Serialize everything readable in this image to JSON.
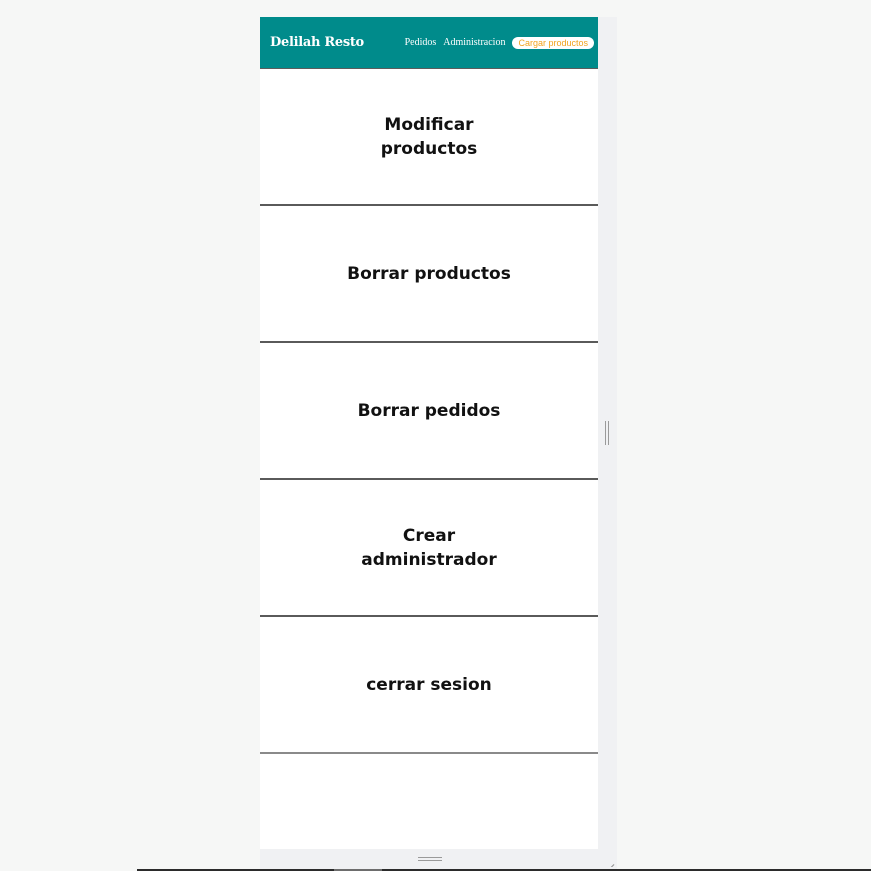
{
  "navbar": {
    "brand": "Delilah Resto",
    "links": [
      "Pedidos",
      "Administracion"
    ],
    "button": "Cargar productos"
  },
  "menu": {
    "items": [
      {
        "label": "Modificar productos"
      },
      {
        "label": "Borrar productos"
      },
      {
        "label": "Borrar pedidos"
      },
      {
        "label": "Crear administrador"
      },
      {
        "label": "cerrar sesion"
      }
    ]
  },
  "colors": {
    "navbar_bg": "#008b8b",
    "button_text": "#f2a21d",
    "divider": "#5a5a5a"
  },
  "icons": {
    "scroll_grip": "vertical-resize-grip-icon",
    "bottom_grip": "horizontal-resize-grip-icon",
    "corner": "resize-corner-icon"
  }
}
